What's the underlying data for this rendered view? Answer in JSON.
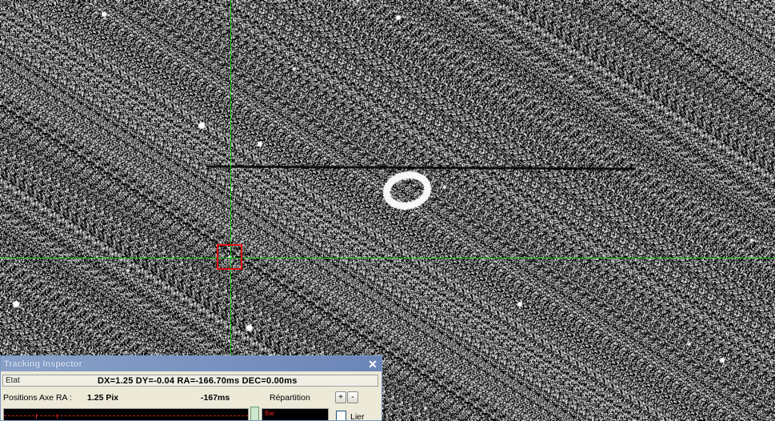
{
  "window": {
    "title": "Tracking Inspector",
    "close_glyph": "✕"
  },
  "status": {
    "label": "Etat",
    "text": "DX=1.25  DY=-0.04 RA=-166.70ms  DEC=0.00ms"
  },
  "positions": {
    "label": "Positions Axe RA :",
    "value": "1.25 Pix",
    "ms": "-167ms",
    "repartition_label": "Répartition",
    "plus_label": "+",
    "minus_label": "-"
  },
  "mini_graph": {
    "label": "Bar"
  },
  "link_checkbox": {
    "label": "Lier",
    "checked": false
  },
  "colors": {
    "crosshair": "#19c419",
    "guide_box": "#e01010",
    "titlebar": "#7a93c2"
  }
}
